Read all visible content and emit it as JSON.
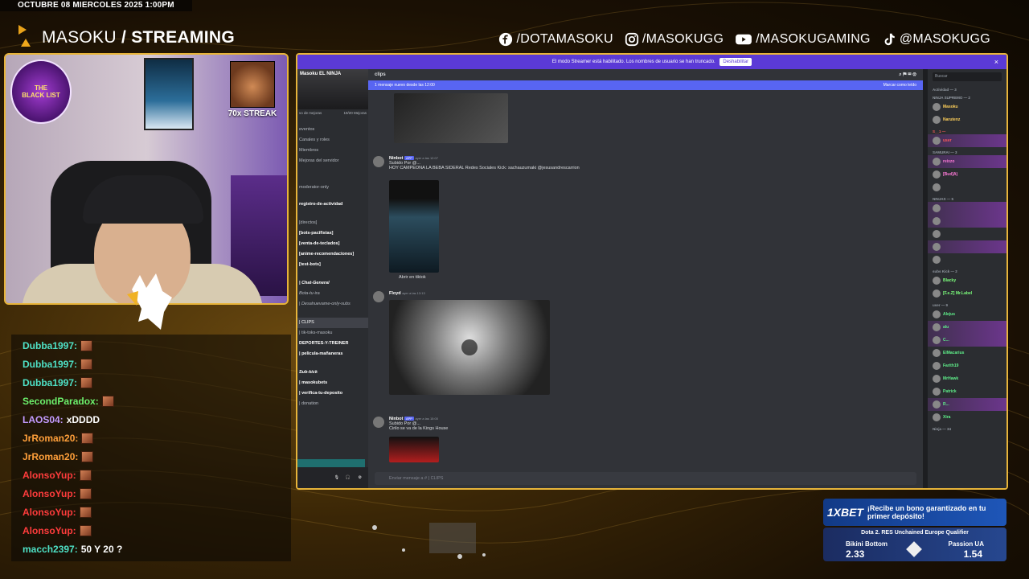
{
  "overlay": {
    "date_line": "OCTUBRE 08 MIERCOLES 2025 1:00PM",
    "brand_name": "MASOKU",
    "brand_sep": "/",
    "brand_section": "STREAMING",
    "socials": [
      {
        "icon": "facebook-icon",
        "handle": "/DOTAMASOKU"
      },
      {
        "icon": "instagram-icon",
        "handle": "/MASOKUGG"
      },
      {
        "icon": "youtube-icon",
        "handle": "/MASOKUGAMING"
      },
      {
        "icon": "tiktok-icon",
        "handle": "@MASOKUGG"
      }
    ],
    "streak_label": "70x STREAK",
    "accent_color": "#e7b43a"
  },
  "chat": {
    "messages": [
      {
        "user": "Dubba1997:",
        "text": "",
        "color": "#4ee1c6",
        "emote": true
      },
      {
        "user": "Dubba1997:",
        "text": "",
        "color": "#4ee1c6",
        "emote": true
      },
      {
        "user": "Dubba1997:",
        "text": "",
        "color": "#4ee1c6",
        "emote": true
      },
      {
        "user": "SecondParadox:",
        "text": "",
        "color": "#6cf06c",
        "emote": true
      },
      {
        "user": "LAOS04:",
        "text": "xDDDD",
        "color": "#c39bff",
        "emote": false
      },
      {
        "user": "JrRoman20:",
        "text": "",
        "color": "#ff9f3a",
        "emote": true
      },
      {
        "user": "JrRoman20:",
        "text": "",
        "color": "#ff9f3a",
        "emote": true
      },
      {
        "user": "AlonsoYup:",
        "text": "",
        "color": "#ff3c3c",
        "emote": true
      },
      {
        "user": "AlonsoYup:",
        "text": "",
        "color": "#ff3c3c",
        "emote": true
      },
      {
        "user": "AlonsoYup:",
        "text": "",
        "color": "#ff3c3c",
        "emote": true
      },
      {
        "user": "AlonsoYup:",
        "text": "",
        "color": "#ff3c3c",
        "emote": true
      },
      {
        "user": "macch2397:",
        "text": "50 Y 20 ?",
        "color": "#4ee1c6",
        "emote": false
      }
    ]
  },
  "discord": {
    "notice": "El modo Streamer está habilitado. Los nombres de usuario se han truncado.",
    "notice_button": "Deshabilitar",
    "server_name": "Masoku EL NINJA",
    "boost_text": "vo de mejoras",
    "boost_count": "19/20 Mejoras",
    "channels": [
      "eventos",
      "Canales y roles",
      "Miembros",
      "Mejoras del servidor",
      "moderator-only",
      "registro-de-actividad",
      "[directos]",
      "[bots-pacifistas]",
      "[venta-de-teclados]",
      "[anime-recomendaciones]",
      "[test-bots]",
      "| Chat-General",
      "Bota-tu-ira",
      "| Desahuevame-only-subs",
      "| CLIPS",
      "| tik-toks-masoku",
      "DEPORTES-Y-TREINER",
      "| pelicula-mañaneras",
      "Sub-kick",
      "| masokubets",
      "| verifica-tu-deposito",
      "| donation"
    ],
    "channel_header": "clips",
    "new_messages": "1 mensaje nuevo desde las 12:00",
    "mark_read": "Marcar como leído",
    "posts": [
      {
        "author": "Ninbot",
        "badge": "APP",
        "time": "ayer a las 12:07",
        "line1": "Subido Por @...",
        "line2": "HOY CAMPEONA LA BEBA SIDERAL Redes Sociales Kick: sachauzumaki @jesusandrescarrion",
        "embed_link": "Abrir en tiktok"
      },
      {
        "author": "Floyd",
        "badge": "",
        "time": "ayer a las 13:13",
        "line1": "",
        "line2": "",
        "embed_link": ""
      },
      {
        "author": "Ninbot",
        "badge": "APP",
        "time": "ayer a las 15:00",
        "line1": "Subido Por @...",
        "line2": "Cirilo se va de la Kings House",
        "embed_link": ""
      }
    ],
    "composer_placeholder": "Enviar mensaje a # | CLIPS",
    "search_placeholder": "Buscar",
    "members_header": "Actividad — 3",
    "member_groups": [
      {
        "title": "NINJA SUPREMO — 2",
        "members": [
          "Masoku",
          "Narutenz"
        ]
      },
      {
        "title": "S__1 —",
        "members": [
          "user"
        ]
      },
      {
        "title": "SAMURAI — 3",
        "members": [
          "reixzo",
          "[Bud]A)",
          "user"
        ]
      },
      {
        "title": "NINJAS — 5",
        "members": [
          "user",
          "user",
          "user",
          "user",
          "user"
        ]
      },
      {
        "title": "subs Kick — 2",
        "members": [
          "Blacky",
          "[F.e.Z] Mr.Label"
        ]
      },
      {
        "title": "user — 9",
        "members": [
          "Alejus",
          "alu",
          "C...",
          "ElMacarius",
          "Farith19",
          "MrHawk",
          "Patrick",
          "R...",
          "Xira"
        ]
      }
    ],
    "members_footer": "Ninja — 34"
  },
  "bet": {
    "brand": "1XBET",
    "promo_text": "¡Recibe un bono garantizado en tu primer depósito!",
    "match_title": "Dota 2. RES Unchained Europe Qualifier",
    "team1": "Bikini Bottom",
    "odds1": "2.33",
    "team2": "Passion UA",
    "odds2": "1.54"
  }
}
